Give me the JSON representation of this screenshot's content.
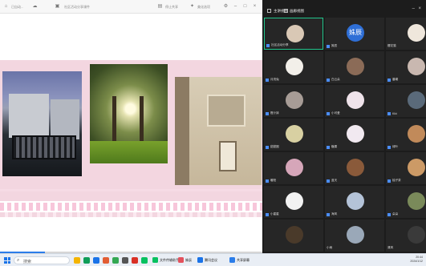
{
  "window": {
    "title_left": "已自动...",
    "doc_title": "社区活动分享课件",
    "right_label": "美化选项",
    "share_btn": "停止共享",
    "share_time": "10:48"
  },
  "panel": {
    "tab_speaker": "主讲视图",
    "tab_gallery": "画廊视图"
  },
  "participants": [
    {
      "name": "社区活动分享",
      "avatar": "photo",
      "active": true,
      "mic": true
    },
    {
      "name": "姝辰",
      "avatar": "text",
      "avatar_text": "姝辰",
      "mic": true
    },
    {
      "name": "樱花猫",
      "avatar": "photo"
    },
    {
      "name": "月亮兔",
      "avatar": "photo",
      "mic": true
    },
    {
      "name": "白云朵",
      "avatar": "photo",
      "mic": true
    },
    {
      "name": "晨曦",
      "avatar": "photo",
      "mic": true
    },
    {
      "name": "橙汁妹",
      "avatar": "photo",
      "mic": true
    },
    {
      "name": "小可爱",
      "avatar": "photo",
      "mic": true
    },
    {
      "name": "Kiki",
      "avatar": "photo",
      "mic": true
    },
    {
      "name": "甜甜圈",
      "avatar": "photo",
      "mic": true
    },
    {
      "name": "糖果",
      "avatar": "photo",
      "mic": true
    },
    {
      "name": "绿叶",
      "avatar": "photo",
      "mic": true
    },
    {
      "name": "暖阳",
      "avatar": "photo",
      "mic": true
    },
    {
      "name": "蓝天",
      "avatar": "photo",
      "mic": true
    },
    {
      "name": "柚子茶",
      "avatar": "photo",
      "mic": true
    },
    {
      "name": "小星星",
      "avatar": "photo",
      "mic": true
    },
    {
      "name": "海风",
      "avatar": "photo",
      "mic": true
    },
    {
      "name": "朵朵",
      "avatar": "photo",
      "mic": true
    },
    {
      "name": "",
      "avatar": "photo"
    },
    {
      "name": "小雨",
      "avatar": "photo"
    },
    {
      "name": "清风",
      "avatar": "photo"
    }
  ],
  "avatar_colors": [
    "#d9c8b5",
    "#2f6fd6",
    "#efe7dc",
    "#f2efe9",
    "#8b6b57",
    "#c9b8b0",
    "#a79c96",
    "#efe3ea",
    "#5a6a7a",
    "#d8d0a2",
    "#f1e9f0",
    "#c18a5a",
    "#d6a6b9",
    "#8a5a3a",
    "#cc9a66",
    "#f2f2f2",
    "#b4c3d8",
    "#7a8a5a",
    "#4a3a2a",
    "#9aa8b8",
    "#3a3a3a"
  ],
  "taskbar": {
    "search_placeholder": "搜索",
    "apps": [
      {
        "label": "文件传输助手",
        "color": "#07c160"
      },
      {
        "label": "姝辰",
        "color": "#e3515c"
      },
      {
        "label": "腾讯会议",
        "color": "#1a73e8"
      },
      {
        "label": "共享屏幕",
        "color": "#2b7de9"
      }
    ],
    "time": "20:44",
    "date": "2024/1/12"
  }
}
